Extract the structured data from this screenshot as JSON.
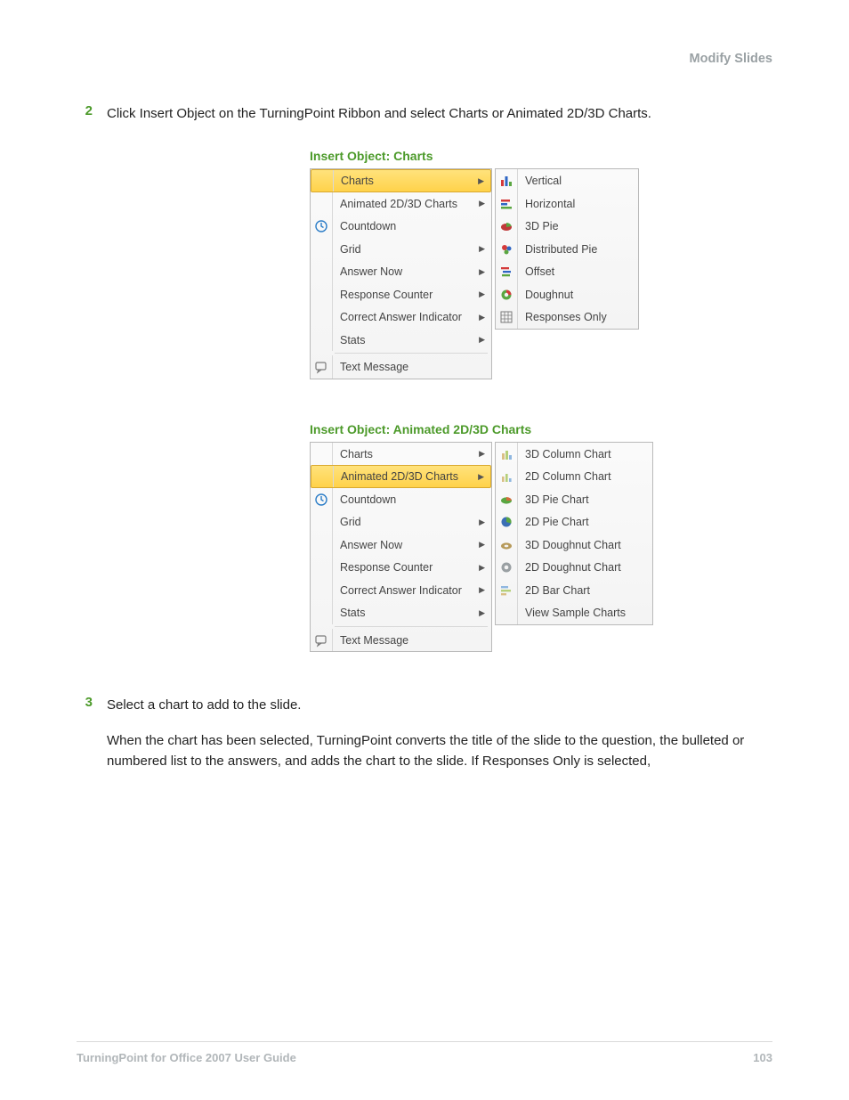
{
  "header": {
    "title": "Modify Slides"
  },
  "steps": {
    "s2": {
      "num": "2",
      "text": "Click Insert Object on the TurningPoint Ribbon and select Charts or Animated 2D/3D Charts."
    },
    "s3": {
      "num": "3",
      "text1": "Select a chart to add to the slide.",
      "text2": "When the chart has been selected, TurningPoint converts the title of the slide to the question, the bulleted or numbered list to the answers, and adds the chart to the slide. If Responses Only is selected,"
    }
  },
  "figure1": {
    "caption": "Insert Object: Charts",
    "main_items": [
      {
        "label": "Charts",
        "arrow": true,
        "highlight": true
      },
      {
        "label": "Animated 2D/3D Charts",
        "arrow": true
      },
      {
        "label": "Countdown",
        "arrow": false,
        "icon": "clock"
      },
      {
        "label": "Grid",
        "arrow": true
      },
      {
        "label": "Answer Now",
        "arrow": true
      },
      {
        "label": "Response Counter",
        "arrow": true
      },
      {
        "label": "Correct Answer Indicator",
        "arrow": true
      },
      {
        "label": "Stats",
        "arrow": true
      },
      {
        "sep": true
      },
      {
        "label": "Text Message",
        "arrow": false,
        "icon": "msg"
      }
    ],
    "sub_items": [
      {
        "label": "Vertical",
        "icon": "vbars"
      },
      {
        "label": "Horizontal",
        "icon": "hbars"
      },
      {
        "label": "3D Pie",
        "icon": "pie3d"
      },
      {
        "label": "Distributed Pie",
        "icon": "distpie"
      },
      {
        "label": "Offset",
        "icon": "offset"
      },
      {
        "label": "Doughnut",
        "icon": "donut"
      },
      {
        "label": "Responses Only",
        "icon": "respgrid"
      }
    ]
  },
  "figure2": {
    "caption": "Insert Object: Animated 2D/3D Charts",
    "main_items": [
      {
        "label": "Charts",
        "arrow": true
      },
      {
        "label": "Animated 2D/3D Charts",
        "arrow": true,
        "highlight": true
      },
      {
        "label": "Countdown",
        "arrow": false,
        "icon": "clock"
      },
      {
        "label": "Grid",
        "arrow": true
      },
      {
        "label": "Answer Now",
        "arrow": true
      },
      {
        "label": "Response Counter",
        "arrow": true
      },
      {
        "label": "Correct Answer Indicator",
        "arrow": true
      },
      {
        "label": "Stats",
        "arrow": true
      },
      {
        "sep": true
      },
      {
        "label": "Text Message",
        "arrow": false,
        "icon": "msg"
      }
    ],
    "sub_items": [
      {
        "label": "3D Column Chart",
        "icon": "col3d"
      },
      {
        "label": "2D Column Chart",
        "icon": "col2d"
      },
      {
        "label": "3D Pie Chart",
        "icon": "pie3db"
      },
      {
        "label": "2D Pie Chart",
        "icon": "pie2d"
      },
      {
        "label": "3D Doughnut Chart",
        "icon": "don3d"
      },
      {
        "label": "2D Doughnut Chart",
        "icon": "don2d"
      },
      {
        "label": "2D Bar Chart",
        "icon": "bar2d"
      },
      {
        "label": "View Sample Charts",
        "icon": ""
      }
    ]
  },
  "footer": {
    "left": "TurningPoint for Office 2007 User Guide",
    "right": "103"
  }
}
